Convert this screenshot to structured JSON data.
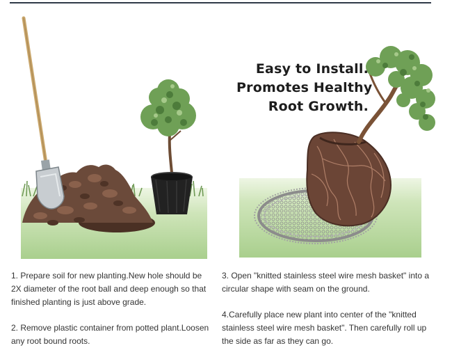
{
  "headline": {
    "line1": "Easy to Install.",
    "line2": "Promotes Healthy",
    "line3": "Root Growth."
  },
  "steps": [
    {
      "text": "1. Prepare soil for new planting.New hole should be 2X diameter of the root ball and deep enough so that finished planting is just above grade."
    },
    {
      "text": "2. Remove plastic container from potted plant.Loosen any root bound roots."
    },
    {
      "text": "3. Open \"knitted stainless steel wire mesh basket\" into a circular shape with  seam on the ground."
    },
    {
      "text": "4.Carefully place new plant into center of the \"knitted stainless steel wire mesh basket\". Then carefully roll up the side as far as they can go."
    }
  ],
  "colors": {
    "ground_green": "#b5d69a",
    "soil_brown": "#6b4a3a",
    "foliage_green": "#6fa056",
    "pot_black": "#222222",
    "mesh_gray": "#9a9a9a"
  }
}
